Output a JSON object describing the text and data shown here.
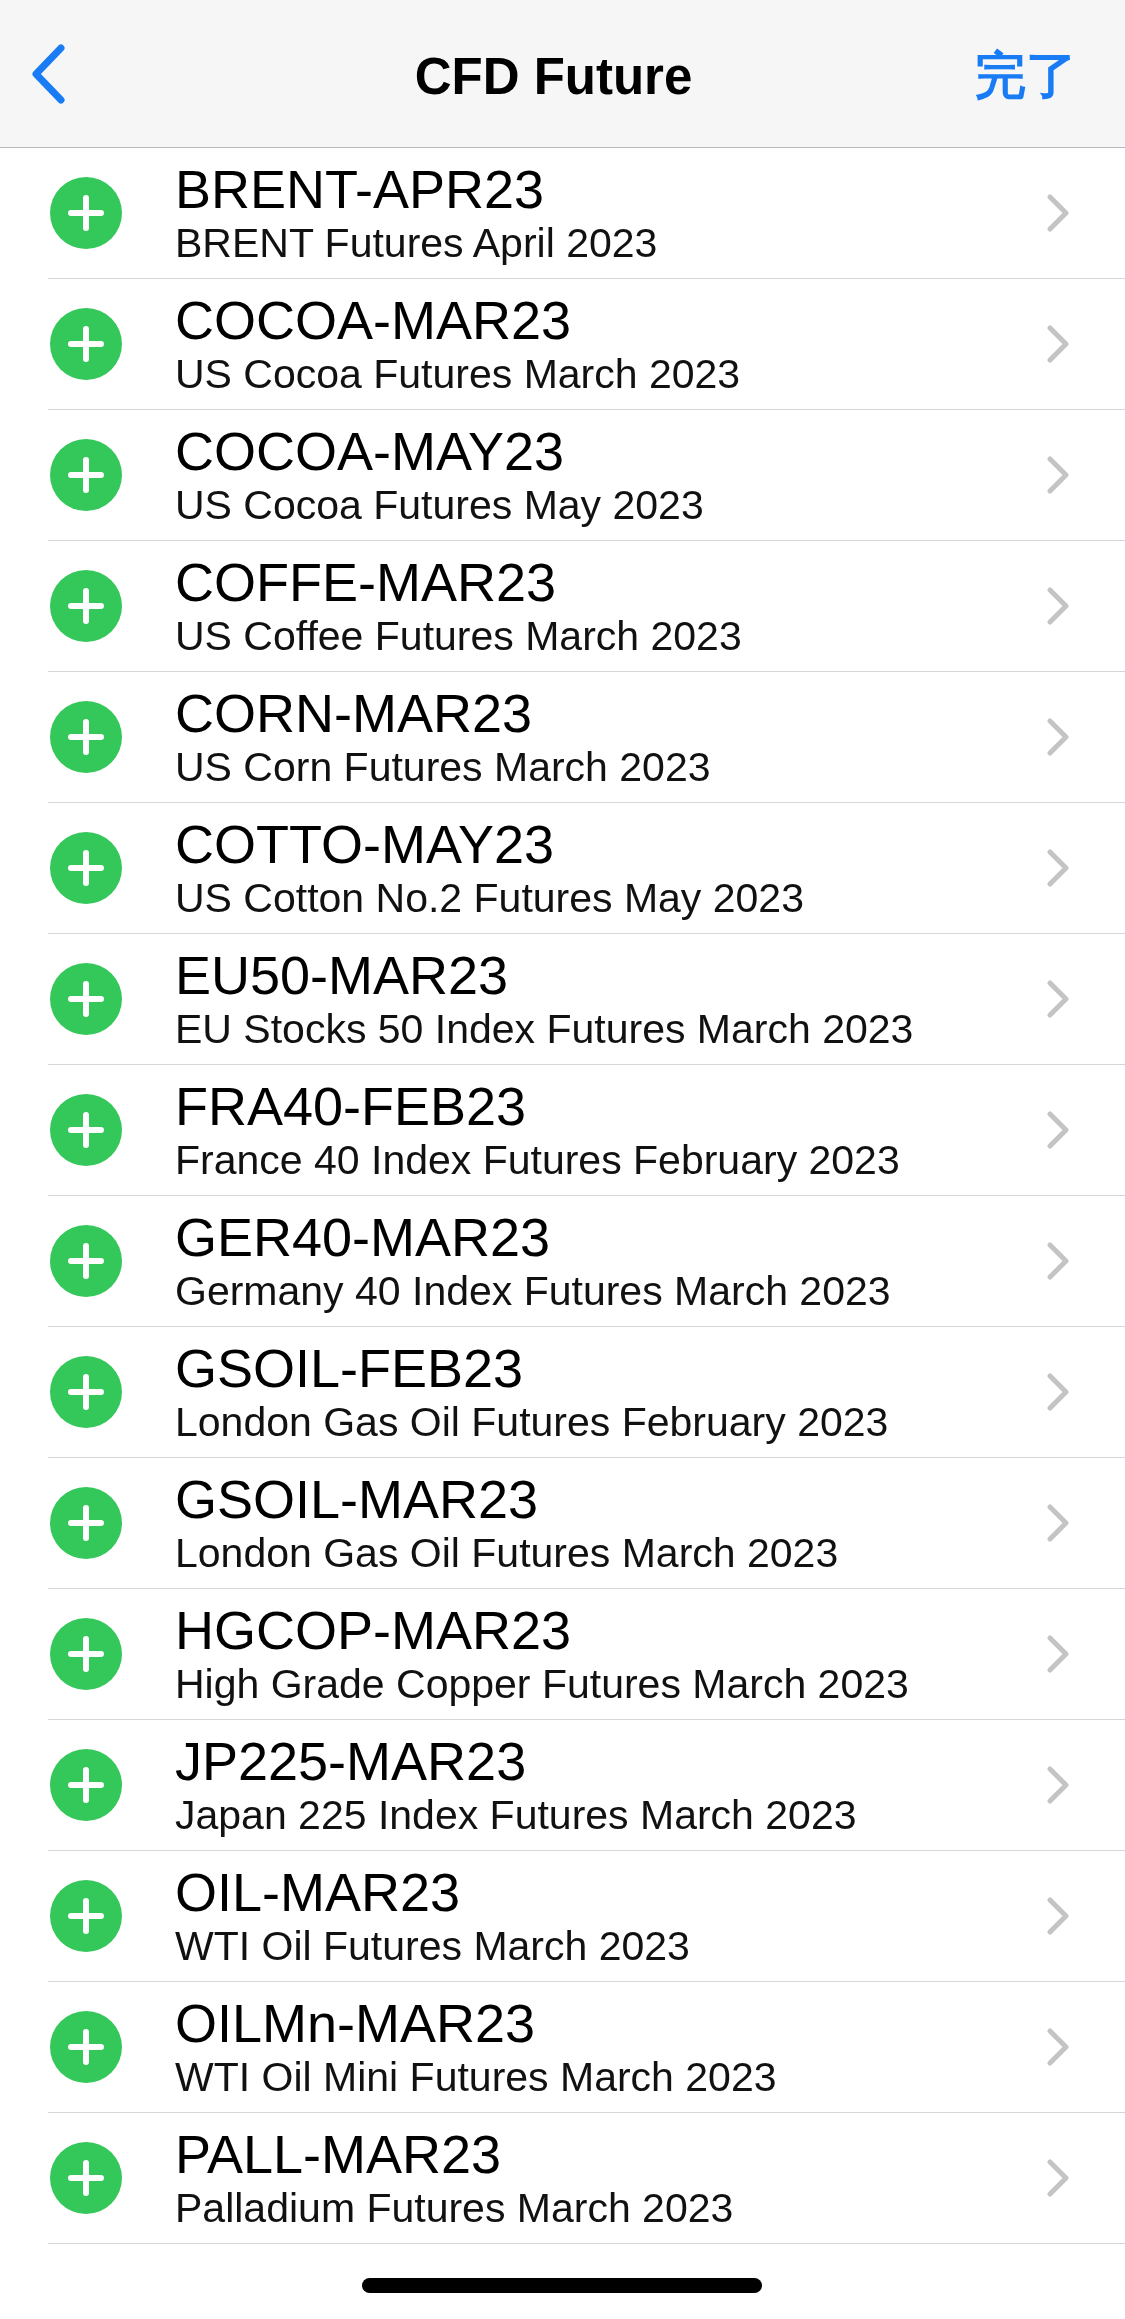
{
  "nav_bar": {
    "title": "CFD Future",
    "done_button": "完了"
  },
  "rows": [
    {
      "symbol": "BRENT-APR23",
      "description": "BRENT Futures April 2023"
    },
    {
      "symbol": "COCOA-MAR23",
      "description": "US Cocoa Futures March 2023"
    },
    {
      "symbol": "COCOA-MAY23",
      "description": "US Cocoa Futures May 2023"
    },
    {
      "symbol": "COFFE-MAR23",
      "description": "US Coffee Futures March 2023"
    },
    {
      "symbol": "CORN-MAR23",
      "description": "US Corn Futures March 2023"
    },
    {
      "symbol": "COTTO-MAY23",
      "description": "US Cotton No.2 Futures May 2023"
    },
    {
      "symbol": "EU50-MAR23",
      "description": "EU Stocks 50 Index Futures March 2023"
    },
    {
      "symbol": "FRA40-FEB23",
      "description": "France 40 Index Futures February 2023"
    },
    {
      "symbol": "GER40-MAR23",
      "description": "Germany 40 Index Futures March 2023"
    },
    {
      "symbol": "GSOIL-FEB23",
      "description": "London Gas Oil Futures February 2023"
    },
    {
      "symbol": "GSOIL-MAR23",
      "description": "London Gas Oil Futures March 2023"
    },
    {
      "symbol": "HGCOP-MAR23",
      "description": "High Grade Copper Futures March 2023"
    },
    {
      "symbol": "JP225-MAR23",
      "description": "Japan 225 Index Futures March 2023"
    },
    {
      "symbol": "OIL-MAR23",
      "description": "WTI Oil Futures March 2023"
    },
    {
      "symbol": "OILMn-MAR23",
      "description": "WTI Oil Mini Futures March 2023"
    },
    {
      "symbol": "PALL-MAR23",
      "description": "Palladium Futures March 2023"
    }
  ]
}
